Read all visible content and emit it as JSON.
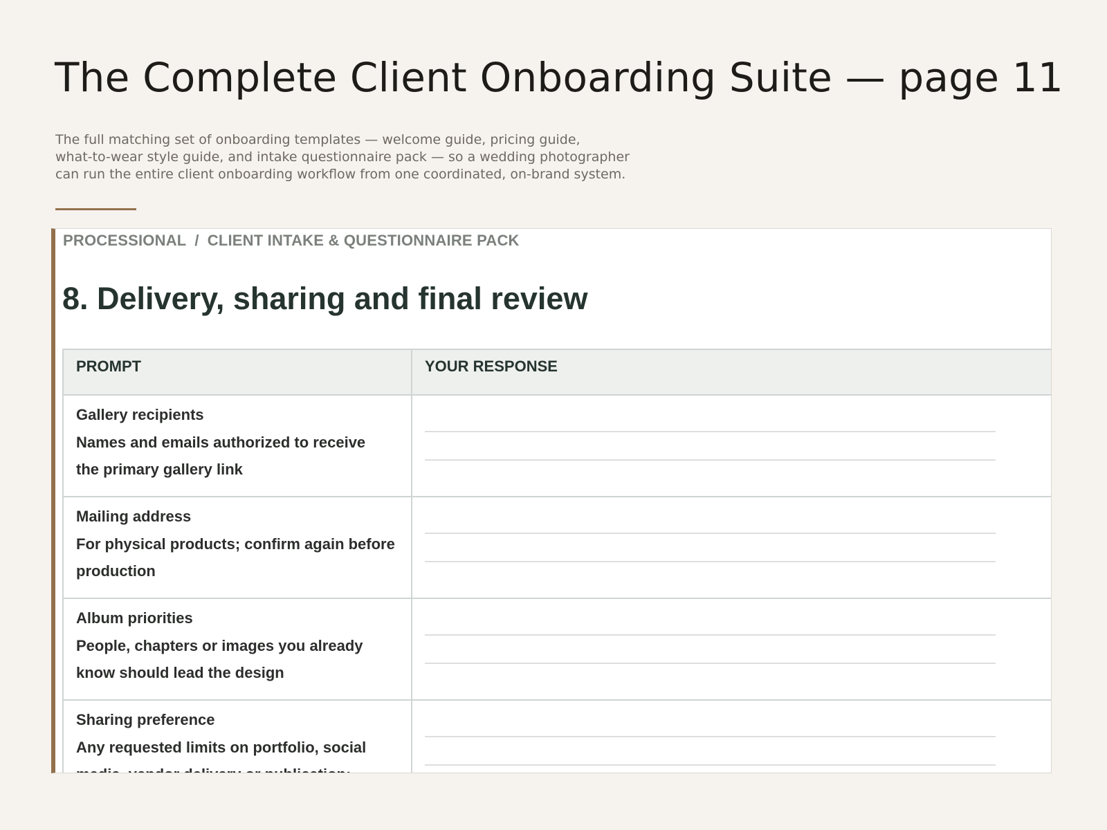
{
  "page": {
    "title": "The Complete Client Onboarding Suite — page 11",
    "description_lines": [
      "The full matching set of onboarding templates — welcome guide, pricing guide,",
      "what-to-wear style guide, and intake questionnaire pack — so a wedding photographer",
      "can run the entire client onboarding workflow from one coordinated, on-brand system."
    ]
  },
  "document": {
    "breadcrumb": {
      "parent": "PROCESSIONAL",
      "separator": "/",
      "current": "CLIENT INTAKE & QUESTIONNAIRE PACK"
    },
    "section_title": "8. Delivery, sharing and final review",
    "table": {
      "headers": [
        "PROMPT",
        "YOUR RESPONSE"
      ],
      "rows": [
        {
          "prompt_lines": [
            "Gallery recipients",
            "Names and emails authorized to receive",
            "the primary gallery link"
          ],
          "response": ""
        },
        {
          "prompt_lines": [
            "Mailing address",
            "For physical products; confirm again before",
            "production"
          ],
          "response": ""
        },
        {
          "prompt_lines": [
            "Album priorities",
            "People, chapters or images you already",
            "know should lead the design"
          ],
          "response": ""
        },
        {
          "prompt_lines": [
            "Sharing preference",
            "Any requested limits on portfolio, social",
            "media, vendor delivery or publication;"
          ],
          "response": ""
        }
      ]
    }
  },
  "colors": {
    "background": "#f6f3ee",
    "accent": "#92714d",
    "heading": "#263430",
    "muted": "#7b807c"
  }
}
